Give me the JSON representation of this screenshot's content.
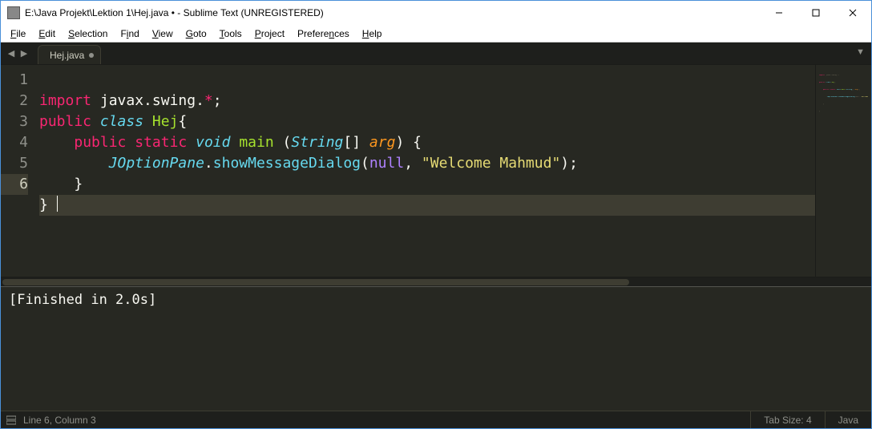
{
  "window": {
    "title": "E:\\Java Projekt\\Lektion 1\\Hej.java • - Sublime Text (UNREGISTERED)"
  },
  "menu": {
    "items": [
      "File",
      "Edit",
      "Selection",
      "Find",
      "View",
      "Goto",
      "Tools",
      "Project",
      "Preferences",
      "Help"
    ]
  },
  "tabs": {
    "items": [
      {
        "label": "Hej.java",
        "dirty": true
      }
    ]
  },
  "editor": {
    "line_numbers": [
      1,
      2,
      3,
      4,
      5,
      6
    ],
    "current_line": 6,
    "code": {
      "l1": {
        "kw": "import",
        "pkg": " javax.swing.",
        "op": "*",
        "semi": ";"
      },
      "l2": {
        "kw1": "public",
        "kw2": "class",
        "cls": "Hej",
        "brace": "{"
      },
      "l3": {
        "kw1": "public",
        "kw2": "static",
        "type": "void",
        "fn": "main",
        "open": " (",
        "ptype": "String",
        "arr": "[]",
        "param": "arg",
        "close": ") {"
      },
      "l4": {
        "obj": "JOptionPane",
        "dot": ".",
        "call": "showMessageDialog",
        "open": "(",
        "null": "null",
        "comma": ", ",
        "str": "\"Welcome Mahmud\"",
        "close": ");"
      },
      "l5": {
        "brace": "}"
      },
      "l6": {
        "brace": "} "
      }
    }
  },
  "output": {
    "text": "[Finished in 2.0s]"
  },
  "status": {
    "position": "Line 6, Column 3",
    "tab_size": "Tab Size: 4",
    "syntax": "Java"
  }
}
